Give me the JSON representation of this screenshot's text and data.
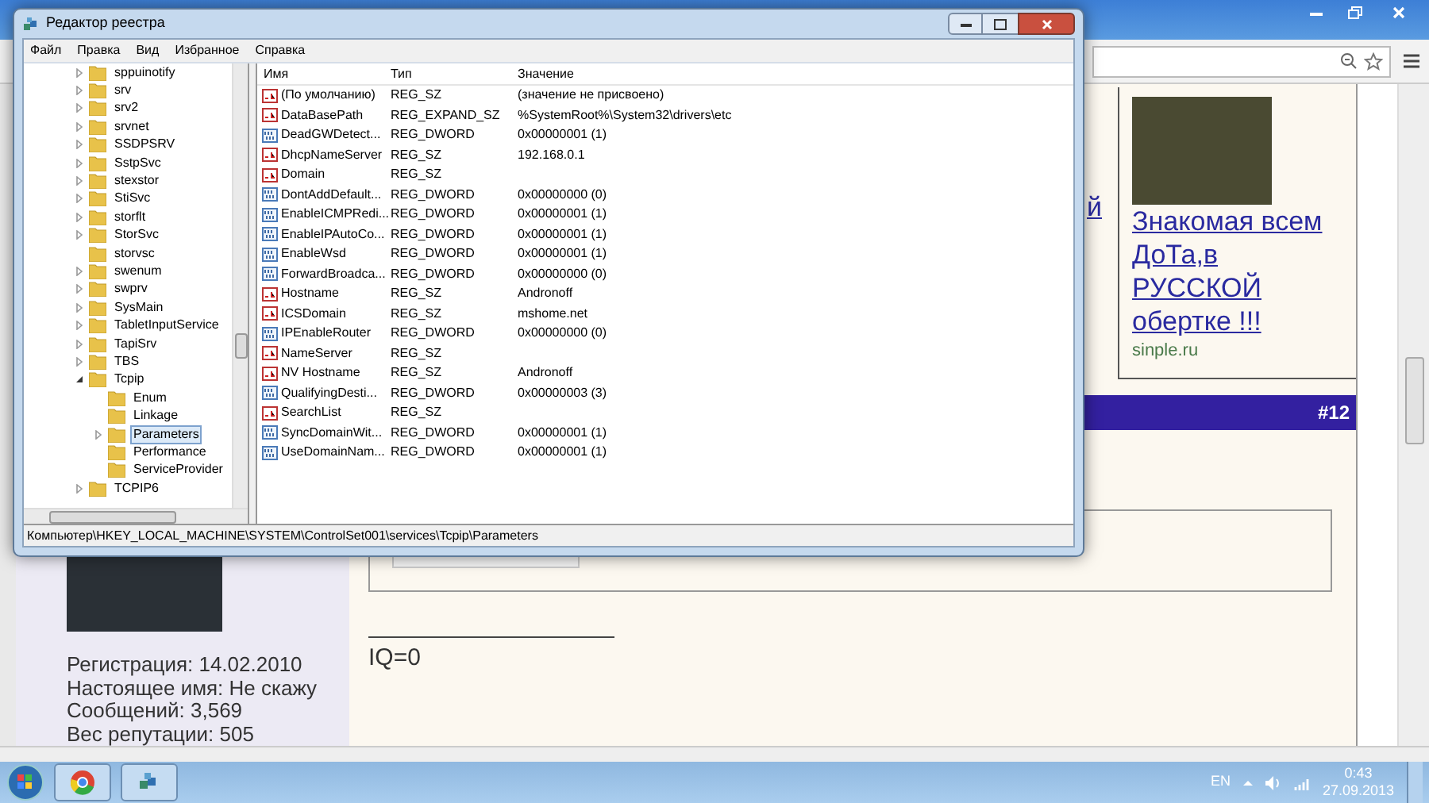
{
  "registry_window": {
    "title": "Редактор реестра",
    "menu": [
      "Файл",
      "Правка",
      "Вид",
      "Избранное",
      "Справка"
    ],
    "tree": [
      {
        "label": "sppuinotify",
        "expandable": true,
        "expanded": false,
        "selected": false
      },
      {
        "label": "srv",
        "expandable": true,
        "expanded": false,
        "selected": false
      },
      {
        "label": "srv2",
        "expandable": true,
        "expanded": false,
        "selected": false
      },
      {
        "label": "srvnet",
        "expandable": true,
        "expanded": false,
        "selected": false
      },
      {
        "label": "SSDPSRV",
        "expandable": true,
        "expanded": false,
        "selected": false
      },
      {
        "label": "SstpSvc",
        "expandable": true,
        "expanded": false,
        "selected": false
      },
      {
        "label": "stexstor",
        "expandable": true,
        "expanded": false,
        "selected": false
      },
      {
        "label": "StiSvc",
        "expandable": true,
        "expanded": false,
        "selected": false
      },
      {
        "label": "storflt",
        "expandable": true,
        "expanded": false,
        "selected": false
      },
      {
        "label": "StorSvc",
        "expandable": true,
        "expanded": false,
        "selected": false
      },
      {
        "label": "storvsc",
        "expandable": false,
        "selected": false
      },
      {
        "label": "swenum",
        "expandable": true,
        "expanded": false,
        "selected": false
      },
      {
        "label": "swprv",
        "expandable": true,
        "expanded": false,
        "selected": false
      },
      {
        "label": "SysMain",
        "expandable": true,
        "expanded": false,
        "selected": false
      },
      {
        "label": "TabletInputService",
        "expandable": true,
        "expanded": false,
        "selected": false
      },
      {
        "label": "TapiSrv",
        "expandable": true,
        "expanded": false,
        "selected": false
      },
      {
        "label": "TBS",
        "expandable": true,
        "expanded": false,
        "selected": false
      },
      {
        "label": "Tcpip",
        "expandable": true,
        "expanded": true,
        "selected": false,
        "children": [
          {
            "label": "Enum",
            "expandable": false,
            "selected": false
          },
          {
            "label": "Linkage",
            "expandable": false,
            "selected": false
          },
          {
            "label": "Parameters",
            "expandable": true,
            "expanded": false,
            "selected": true
          },
          {
            "label": "Performance",
            "expandable": false,
            "selected": false
          },
          {
            "label": "ServiceProvider",
            "expandable": false,
            "selected": false
          }
        ]
      },
      {
        "label": "TCPIP6",
        "expandable": true,
        "expanded": false,
        "selected": false
      }
    ],
    "columns": [
      "Имя",
      "Тип",
      "Значение"
    ],
    "rows": [
      {
        "kind": "string",
        "name": "(По умолчанию)",
        "type": "REG_SZ",
        "value": "(значение не присвоено)"
      },
      {
        "kind": "string",
        "name": "DataBasePath",
        "type": "REG_EXPAND_SZ",
        "value": "%SystemRoot%\\System32\\drivers\\etc"
      },
      {
        "kind": "number",
        "name": "DeadGWDetect...",
        "type": "REG_DWORD",
        "value": "0x00000001 (1)"
      },
      {
        "kind": "string",
        "name": "DhcpNameServer",
        "type": "REG_SZ",
        "value": "192.168.0.1"
      },
      {
        "kind": "string",
        "name": "Domain",
        "type": "REG_SZ"
      },
      {
        "kind": "number",
        "name": "DontAddDefault...",
        "type": "REG_DWORD",
        "value": "0x00000000 (0)"
      },
      {
        "kind": "number",
        "name": "EnableICMPRedi...",
        "type": "REG_DWORD",
        "value": "0x00000001 (1)"
      },
      {
        "kind": "number",
        "name": "EnableIPAutoCo...",
        "type": "REG_DWORD",
        "value": "0x00000001 (1)"
      },
      {
        "kind": "number",
        "name": "EnableWsd",
        "type": "REG_DWORD",
        "value": "0x00000001 (1)"
      },
      {
        "kind": "number",
        "name": "ForwardBroadca...",
        "type": "REG_DWORD",
        "value": "0x00000000 (0)"
      },
      {
        "kind": "string",
        "name": "Hostname",
        "type": "REG_SZ",
        "value": "Andronoff"
      },
      {
        "kind": "string",
        "name": "ICSDomain",
        "type": "REG_SZ",
        "value": "mshome.net"
      },
      {
        "kind": "number",
        "name": "IPEnableRouter",
        "type": "REG_DWORD",
        "value": "0x00000000 (0)"
      },
      {
        "kind": "string",
        "name": "NameServer",
        "type": "REG_SZ"
      },
      {
        "kind": "string",
        "name": "NV Hostname",
        "type": "REG_SZ",
        "value": "Andronoff"
      },
      {
        "kind": "number",
        "name": "QualifyingDesti...",
        "type": "REG_DWORD",
        "value": "0x00000003 (3)"
      },
      {
        "kind": "string",
        "name": "SearchList",
        "type": "REG_SZ"
      },
      {
        "kind": "number",
        "name": "SyncDomainWit...",
        "type": "REG_DWORD",
        "value": "0x00000001 (1)"
      },
      {
        "kind": "number",
        "name": "UseDomainNam...",
        "type": "REG_DWORD",
        "value": "0x00000001 (1)"
      }
    ],
    "status_bar": "Компьютер\\HKEY_LOCAL_MACHINE\\SYSTEM\\ControlSet001\\services\\Tcpip\\Parameters"
  },
  "browser": {
    "cut_link": "й",
    "ad": {
      "link": "Знакомая всем ДоТа,в РУССКОЙ обертке !!!",
      "source": "sinple.ru"
    },
    "post": {
      "number": "#12",
      "user_info": [
        "Регистрация: 14.02.2010",
        "Настоящее имя: Не скажу",
        "Сообщений: 3,569",
        "Вес репутации: 505"
      ],
      "signature": "IQ=0"
    }
  },
  "taskbar": {
    "language": "EN",
    "time": "0:43",
    "date": "27.09.2013"
  }
}
